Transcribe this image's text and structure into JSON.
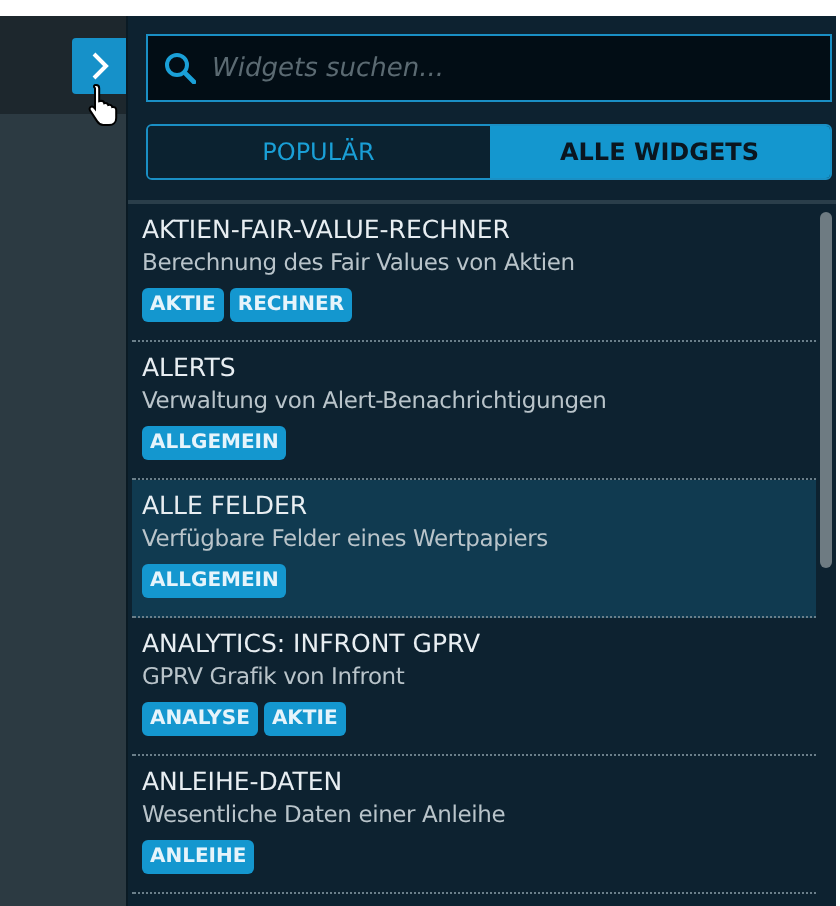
{
  "search": {
    "placeholder": "Widgets suchen..."
  },
  "tabs": [
    {
      "label": "POPULÄR",
      "selected": false
    },
    {
      "label": "ALLE WIDGETS",
      "selected": true
    }
  ],
  "widgets": [
    {
      "title": "AKTIEN-FAIR-VALUE-RECHNER",
      "description": "Berechnung des Fair Values von Aktien",
      "tags": [
        "AKTIE",
        "RECHNER"
      ],
      "selected": false
    },
    {
      "title": "ALERTS",
      "description": "Verwaltung von Alert-Benachrichtigungen",
      "tags": [
        "ALLGEMEIN"
      ],
      "selected": false
    },
    {
      "title": "ALLE FELDER",
      "description": "Verfügbare Felder eines Wertpapiers",
      "tags": [
        "ALLGEMEIN"
      ],
      "selected": true
    },
    {
      "title": "ANALYTICS: INFRONT GPRV",
      "description": "GPRV Grafik von Infront",
      "tags": [
        "ANALYSE",
        "AKTIE"
      ],
      "selected": false
    },
    {
      "title": "ANLEIHE-DATEN",
      "description": "Wesentliche Daten einer Anleihe",
      "tags": [
        "ANLEIHE"
      ],
      "selected": false
    }
  ]
}
